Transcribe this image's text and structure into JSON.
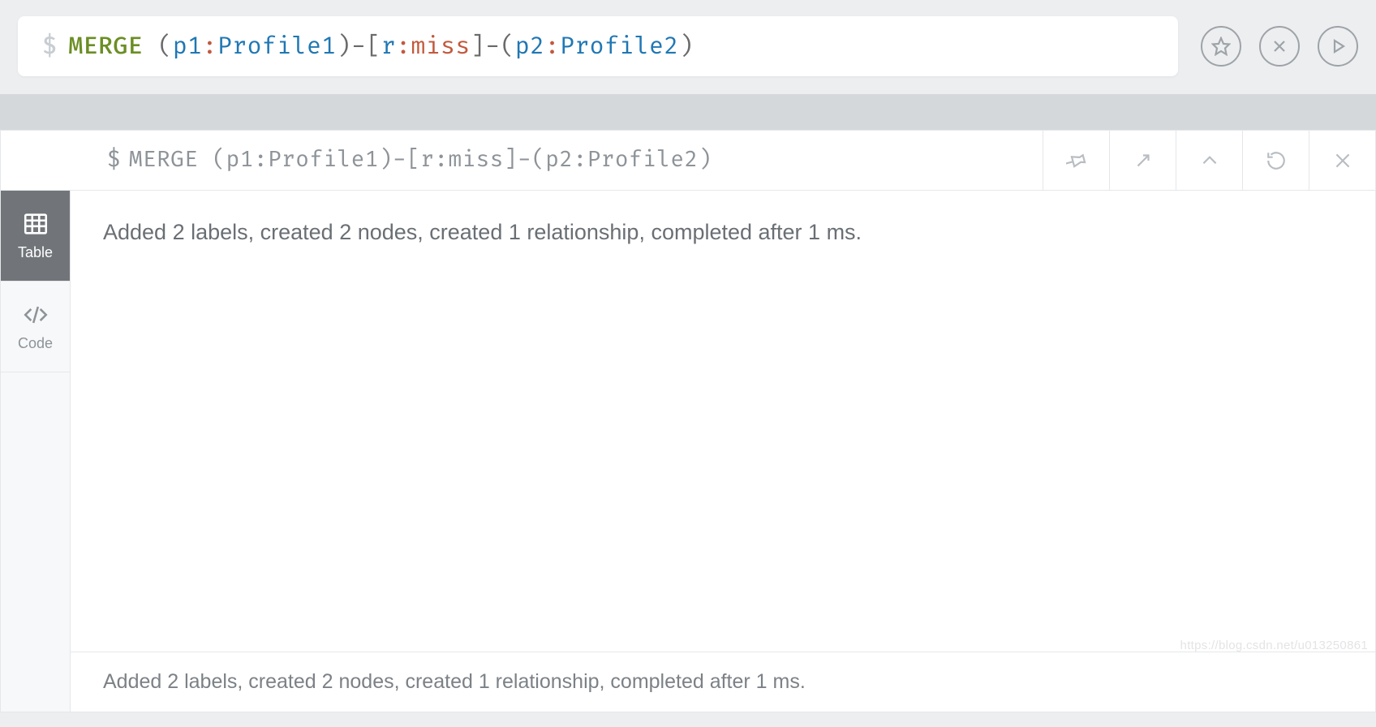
{
  "editor": {
    "prompt": "$",
    "tokens": {
      "keyword": "MERGE",
      "lp1": "(",
      "v1": "p1",
      "c1": ":",
      "t1": "Profile1",
      "rp1": ")",
      "d1": "-",
      "lb": "[",
      "rv": "r",
      "c2": ":",
      "rel": "miss",
      "rb": "]",
      "d2": "-",
      "lp2": "(",
      "v2": "p2",
      "c3": ":",
      "t2": "Profile2",
      "rp2": ")"
    },
    "actions": {
      "favorite": "favorite",
      "clear": "clear",
      "run": "run"
    }
  },
  "result": {
    "prompt": "$",
    "query_plain": "MERGE (p1:Profile1)-[r:miss]-(p2:Profile2)",
    "header_tools": {
      "pin": "pin",
      "expand": "expand",
      "collapse": "collapse",
      "rerun": "rerun",
      "close": "close"
    },
    "tabs": {
      "table": "Table",
      "code": "Code"
    },
    "message": "Added 2 labels, created 2 nodes, created 1 relationship, completed after 1 ms.",
    "footer": "Added 2 labels, created 2 nodes, created 1 relationship, completed after 1 ms."
  },
  "watermark": "https://blog.csdn.net/u013250861"
}
